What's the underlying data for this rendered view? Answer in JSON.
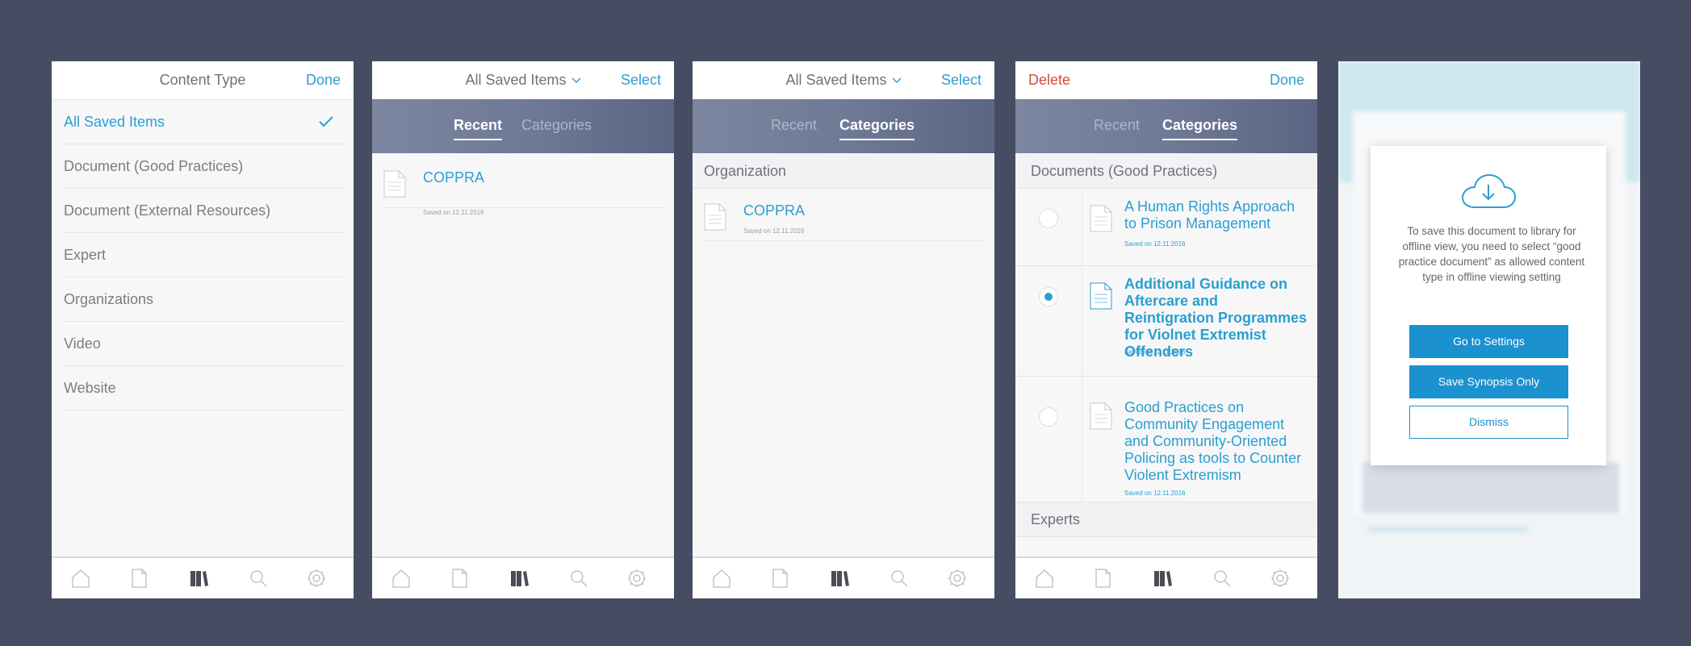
{
  "colors": {
    "background": "#464d63",
    "accent": "#2a9fd0",
    "destructive": "#d94a35",
    "segment_bar": "#6f7a96"
  },
  "screen1": {
    "title": "Content Type",
    "done": "Done",
    "items": [
      {
        "label": "All Saved Items",
        "selected": true
      },
      {
        "label": "Document (Good Practices)"
      },
      {
        "label": "Document (External Resources)"
      },
      {
        "label": "Expert"
      },
      {
        "label": "Organizations"
      },
      {
        "label": "Video"
      },
      {
        "label": "Website"
      }
    ]
  },
  "screen2": {
    "title": "All Saved Items",
    "select": "Select",
    "tabs": {
      "recent": "Recent",
      "categories": "Categories",
      "active": "recent"
    },
    "items": [
      {
        "title": "COPPRA",
        "date": "Saved on 12.11.2016"
      }
    ]
  },
  "screen3": {
    "title": "All Saved Items",
    "select": "Select",
    "tabs": {
      "recent": "Recent",
      "categories": "Categories",
      "active": "categories"
    },
    "section": "Organization",
    "items": [
      {
        "title": "COPPRA",
        "date": "Saved on 12.11.2016"
      }
    ]
  },
  "screen4": {
    "delete": "Delete",
    "done": "Done",
    "tabs": {
      "recent": "Recent",
      "categories": "Categories",
      "active": "categories"
    },
    "section": "Documents (Good Practices)",
    "items": [
      {
        "title": "A Human Rights Approach to Prison Management",
        "date": "Saved on 12.11.2016",
        "selected": false
      },
      {
        "title": "Additional Guidance on Aftercare and Reintigration Programmes for Violnet Extremist Offenders",
        "date": "Saved on 12.11.2016",
        "selected": true
      },
      {
        "title": "Good Practices on Community Engagement and Community-Oriented Policing as tools to Counter Violent Extremism",
        "date": "Saved on 12.11.2016",
        "selected": false
      }
    ],
    "section2": "Experts"
  },
  "screen5": {
    "modal": {
      "icon": "cloud-download-icon",
      "message": "To save this document to library for offline view, you need to select “good practice document” as allowed content type in offline viewing setting",
      "buttons": {
        "settings": "Go to Settings",
        "synopsis": "Save Synopsis Only",
        "dismiss": "Dismiss"
      }
    }
  },
  "tabbar": {
    "icons": [
      "home-icon",
      "document-icon",
      "library-icon",
      "search-icon",
      "settings-icon"
    ],
    "active": "library-icon"
  }
}
